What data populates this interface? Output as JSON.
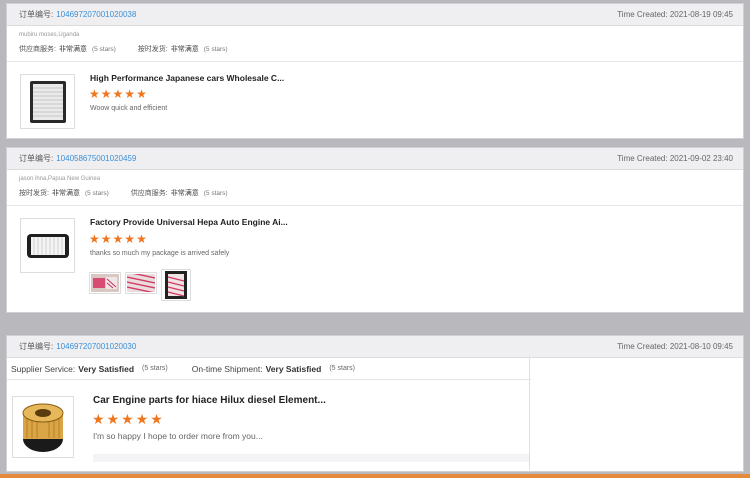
{
  "orders": [
    {
      "order_label": "订单编号:",
      "order_id": "104697207001020038",
      "time_created": "Time Created: 2021-08-19 09:45",
      "buyer": "mubiru moses,Uganda",
      "ratings": [
        {
          "label": "供应商服务:",
          "value": "非常满意",
          "note": "(5 stars)"
        },
        {
          "label": "按时发货:",
          "value": "非常满意",
          "note": "(5 stars)"
        }
      ],
      "product_title": "High Performance Japanese cars Wholesale C...",
      "stars": 5,
      "comment": "Woow quick and efficient",
      "thumb_icon": "air-filter-panel"
    },
    {
      "order_label": "订单编号:",
      "order_id": "104058675001020459",
      "time_created": "Time Created: 2021-09-02 23:40",
      "buyer": "jason ihna,Papua New Guinea",
      "ratings": [
        {
          "label": "按时发货:",
          "value": "非常满意",
          "note": "(5 stars)"
        },
        {
          "label": "供应商服务:",
          "value": "非常满意",
          "note": "(5 stars)"
        }
      ],
      "product_title": "Factory Provide Universal Hepa Auto Engine Ai...",
      "stars": 5,
      "comment": "thanks so much my package is arrived safely",
      "thumb_icon": "air-filter-frame",
      "photos": [
        "photo-1",
        "photo-2",
        "photo-3"
      ]
    },
    {
      "order_label": "订单编号:",
      "order_id": "104697207001020030",
      "time_created": "Time Created: 2021-08-10 09:45",
      "ratings": [
        {
          "label": "Supplier Service:",
          "value": "Very Satisfied",
          "note": "(5 stars)"
        },
        {
          "label": "On-time Shipment:",
          "value": "Very Satisfied",
          "note": "(5 stars)"
        }
      ],
      "product_title": "Car Engine parts for hiace Hilux diesel Element...",
      "stars": 5,
      "comment": "I'm so happy I hope to order more from you...",
      "thumb_icon": "fuel-filter"
    }
  ],
  "colors": {
    "star": "#f0761e",
    "link": "#3b8fd6",
    "accent_bar": "#e58a3a"
  }
}
